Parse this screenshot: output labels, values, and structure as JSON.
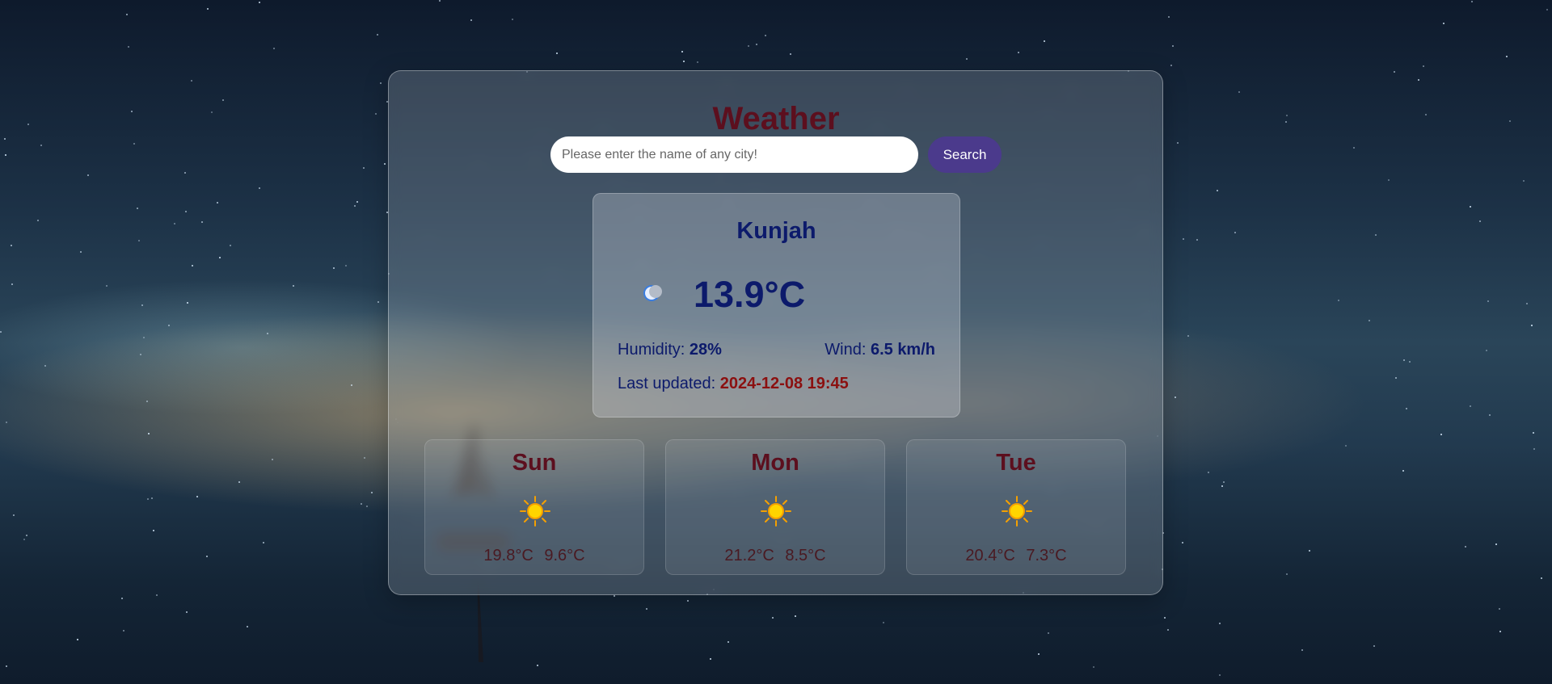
{
  "header": {
    "title": "Weather"
  },
  "search": {
    "placeholder": "Please enter the name of any city!",
    "button_label": "Search"
  },
  "current": {
    "city": "Kunjah",
    "temperature": "13.9°C",
    "humidity_label": "Humidity:",
    "humidity_value": "28%",
    "wind_label": "Wind:",
    "wind_value": "6.5 km/h",
    "updated_label": "Last updated:",
    "updated_value": "2024-12-08 19:45",
    "icon": "moon-icon"
  },
  "forecast": [
    {
      "day": "Sun",
      "icon": "sun-icon",
      "max": "19.8°C",
      "min": "9.6°C"
    },
    {
      "day": "Mon",
      "icon": "sun-icon",
      "max": "21.2°C",
      "min": "8.5°C"
    },
    {
      "day": "Tue",
      "icon": "sun-icon",
      "max": "20.4°C",
      "min": "7.3°C"
    }
  ],
  "colors": {
    "title": "#5c0f1e",
    "current_text": "#0c1a6b",
    "updated_value": "#8b1010",
    "search_button": "#4b3a8c"
  }
}
